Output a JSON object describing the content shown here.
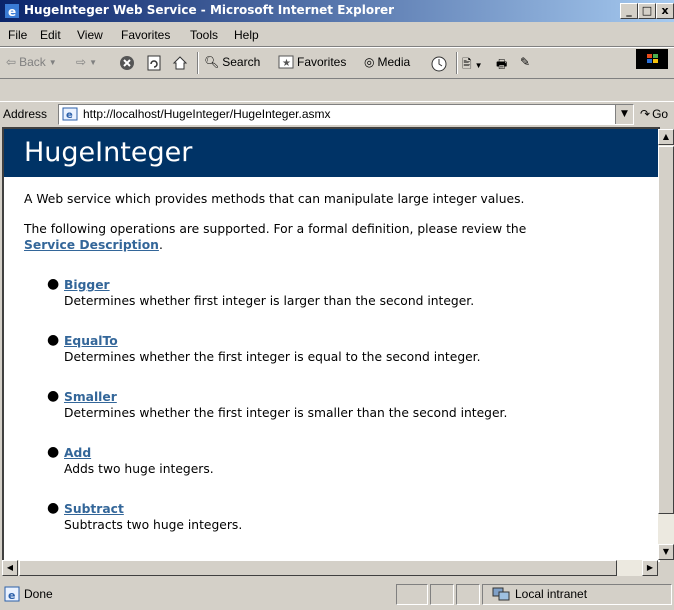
{
  "window": {
    "title": "HugeInteger Web Service - Microsoft Internet Explorer"
  },
  "menu": [
    "File",
    "Edit",
    "View",
    "Favorites",
    "Tools",
    "Help"
  ],
  "toolbar": {
    "back": "Back",
    "search": "Search",
    "favorites": "Favorites",
    "media": "Media"
  },
  "address": {
    "label": "Address",
    "url": "http://localhost/HugeInteger/HugeInteger.asmx",
    "go": "Go"
  },
  "page": {
    "heading": "HugeInteger",
    "intro": "A Web service which provides methods that can manipulate large integer values.",
    "supported": "The following operations are supported. For a formal definition, please review the",
    "service_description_link": "Service Description",
    "operations": [
      {
        "name": "Bigger",
        "description": "Determines whether first integer is larger than the second integer."
      },
      {
        "name": "EqualTo",
        "description": "Determines whether the first integer is equal to the second integer."
      },
      {
        "name": "Smaller",
        "description": "Determines whether the first integer is smaller than the second integer."
      },
      {
        "name": "Add",
        "description": "Adds two huge integers."
      },
      {
        "name": "Subtract",
        "description": "Subtracts two huge integers."
      }
    ]
  },
  "status": {
    "text": "Done",
    "zone": "Local intranet"
  },
  "colors": {
    "heading_bg": "#003366",
    "link": "#336699",
    "titlebar_start": "#0a246a"
  }
}
